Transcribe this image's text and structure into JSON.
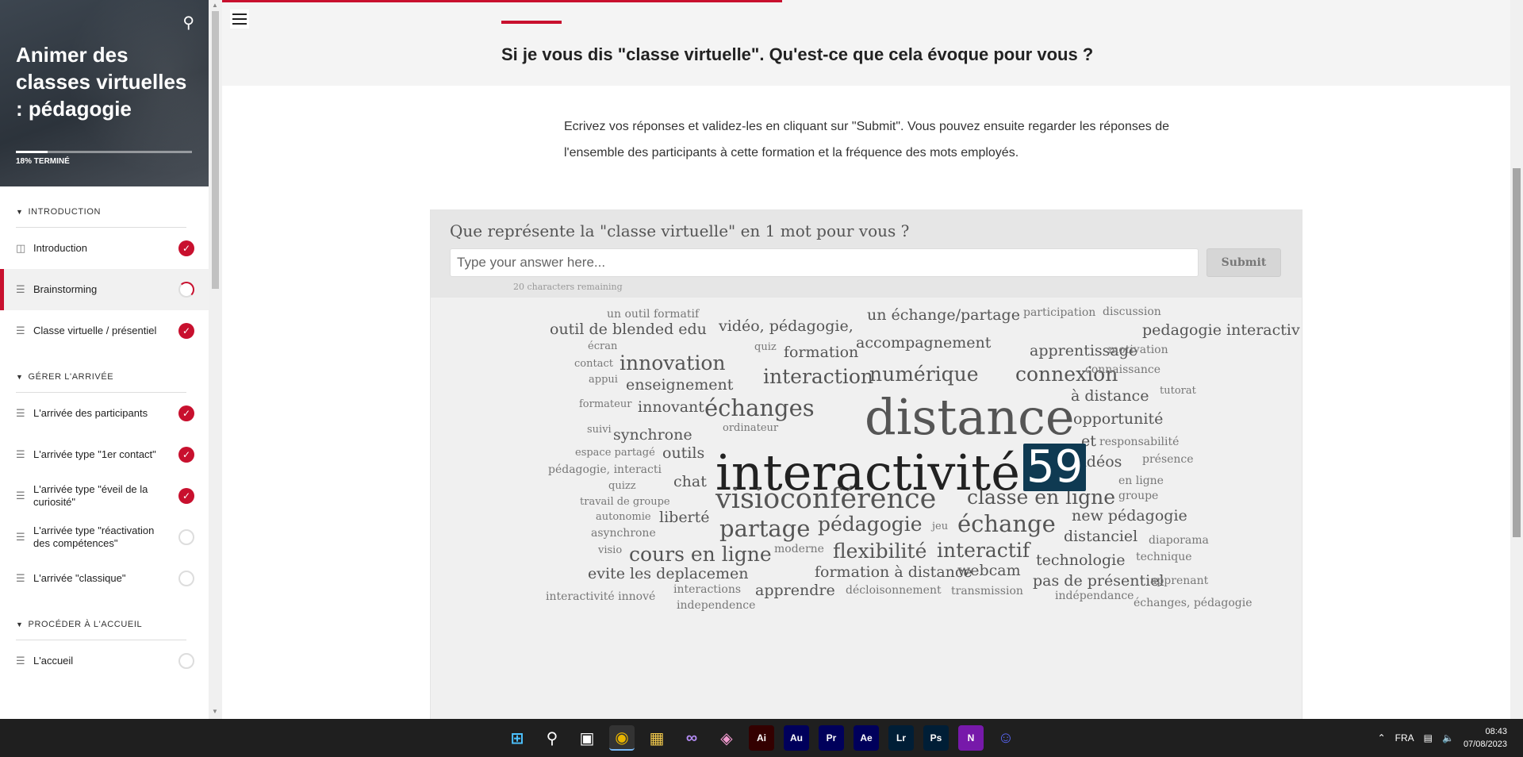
{
  "course": {
    "title": "Animer des classes virtuelles : pédagogie",
    "progress_label": "18% TERMINÉ",
    "progress_value": 0.18
  },
  "sidebar": {
    "sections": [
      {
        "title": "INTRODUCTION",
        "lessons": [
          {
            "label": "Introduction",
            "icon": "video-icon",
            "status": "done"
          },
          {
            "label": "Brainstorming",
            "icon": "lines-icon",
            "status": "partial",
            "active": true
          },
          {
            "label": "Classe virtuelle / présentiel",
            "icon": "lines-icon",
            "status": "done"
          }
        ]
      },
      {
        "title": "GÉRER L'ARRIVÉE",
        "lessons": [
          {
            "label": "L'arrivée des participants",
            "icon": "lines-icon",
            "status": "done"
          },
          {
            "label": "L'arrivée type \"1er contact\"",
            "icon": "lines-icon",
            "status": "done"
          },
          {
            "label": "L'arrivée type \"éveil de la curiosité\"",
            "icon": "lines-icon",
            "status": "done"
          },
          {
            "label": "L'arrivée type \"réactivation des compétences\"",
            "icon": "lines-icon",
            "status": "empty"
          },
          {
            "label": "L'arrivée \"classique\"",
            "icon": "lines-icon",
            "status": "empty"
          }
        ]
      },
      {
        "title": "PROCÉDER À L'ACCUEIL",
        "lessons": [
          {
            "label": "L'accueil",
            "icon": "lines-icon",
            "status": "empty"
          }
        ]
      }
    ]
  },
  "main": {
    "question": "Si je vous dis \"classe virtuelle\". Qu'est-ce que cela évoque pour vous ?",
    "intro": "Ecrivez vos réponses et validez-les en cliquant sur \"Submit\". Vous pouvez ensuite regarder les réponses de l'ensemble des participants à cette formation et la fréquence des mots employés.",
    "widget": {
      "question": "Que représente la \"classe virtuelle\" en 1 mot pour vous ?",
      "input_placeholder": "Type your answer here...",
      "submit_label": "Submit",
      "chars_remaining": "20 characters remaining"
    },
    "hovered_count": "59",
    "word_cloud": [
      {
        "text": "un outil formatif",
        "size": 14
      },
      {
        "text": "outil de blended edu",
        "size": 19
      },
      {
        "text": "vidéo, pédagogie,",
        "size": 19
      },
      {
        "text": "un échange/partage",
        "size": 19
      },
      {
        "text": "participation",
        "size": 14
      },
      {
        "text": "discussion",
        "size": 14
      },
      {
        "text": "pedagogie interactiv",
        "size": 19
      },
      {
        "text": "écran",
        "size": 13
      },
      {
        "text": "quiz",
        "size": 13
      },
      {
        "text": "contact",
        "size": 13
      },
      {
        "text": "innovation",
        "size": 25
      },
      {
        "text": "formation",
        "size": 19
      },
      {
        "text": "accompagnement",
        "size": 19
      },
      {
        "text": "apprentissage",
        "size": 19
      },
      {
        "text": "motivation",
        "size": 14
      },
      {
        "text": "appui",
        "size": 13
      },
      {
        "text": "enseignement",
        "size": 19
      },
      {
        "text": "interaction",
        "size": 25
      },
      {
        "text": "numérique",
        "size": 25
      },
      {
        "text": "connexion",
        "size": 25
      },
      {
        "text": "connaissance",
        "size": 14
      },
      {
        "text": "formateur",
        "size": 13
      },
      {
        "text": "innovant",
        "size": 19
      },
      {
        "text": "échanges",
        "size": 29
      },
      {
        "text": "distance",
        "size": 62
      },
      {
        "text": "à distance",
        "size": 19
      },
      {
        "text": "tutorat",
        "size": 13
      },
      {
        "text": "opportunité",
        "size": 19
      },
      {
        "text": "suivi",
        "size": 13
      },
      {
        "text": "synchrone",
        "size": 19
      },
      {
        "text": "ordinateur",
        "size": 13
      },
      {
        "text": "interactivité",
        "size": 62
      },
      {
        "text": "et",
        "size": 19
      },
      {
        "text": "responsabilité",
        "size": 14
      },
      {
        "text": "espace partagé",
        "size": 13
      },
      {
        "text": "outils",
        "size": 19
      },
      {
        "text": "vidéos",
        "size": 19
      },
      {
        "text": "présence",
        "size": 14
      },
      {
        "text": "pédagogie, interacti",
        "size": 14
      },
      {
        "text": "chat",
        "size": 19
      },
      {
        "text": "en ligne",
        "size": 14
      },
      {
        "text": "quizz",
        "size": 13
      },
      {
        "text": "visioconférence",
        "size": 35
      },
      {
        "text": "classe en ligne",
        "size": 25
      },
      {
        "text": "travail de groupe",
        "size": 13
      },
      {
        "text": "groupe",
        "size": 14
      },
      {
        "text": "autonomie",
        "size": 13
      },
      {
        "text": "liberté",
        "size": 19
      },
      {
        "text": "partage",
        "size": 29
      },
      {
        "text": "pédagogie",
        "size": 25
      },
      {
        "text": "jeu",
        "size": 13
      },
      {
        "text": "échange",
        "size": 29
      },
      {
        "text": "new pédagogie",
        "size": 19
      },
      {
        "text": "asynchrone",
        "size": 14
      },
      {
        "text": "distanciel",
        "size": 19
      },
      {
        "text": "diaporama",
        "size": 14
      },
      {
        "text": "visio",
        "size": 13
      },
      {
        "text": "cours en ligne",
        "size": 25
      },
      {
        "text": "moderne",
        "size": 14
      },
      {
        "text": "flexibilité",
        "size": 25
      },
      {
        "text": "interactif",
        "size": 25
      },
      {
        "text": "technologie",
        "size": 19
      },
      {
        "text": "technique",
        "size": 14
      },
      {
        "text": "evite les deplacemen",
        "size": 19
      },
      {
        "text": "formation à distance",
        "size": 19
      },
      {
        "text": "webcam",
        "size": 19
      },
      {
        "text": "interactions",
        "size": 14
      },
      {
        "text": "apprendre",
        "size": 19
      },
      {
        "text": "décloisonnement",
        "size": 14
      },
      {
        "text": "transmission",
        "size": 14
      },
      {
        "text": "pas de présentiel",
        "size": 19
      },
      {
        "text": "apprenant",
        "size": 14
      },
      {
        "text": "interactivité innové",
        "size": 14
      },
      {
        "text": "indépendance",
        "size": 14
      },
      {
        "text": "independence",
        "size": 14
      },
      {
        "text": "échanges, pédagogie",
        "size": 14
      }
    ]
  },
  "taskbar": {
    "apps": [
      "windows-start",
      "search",
      "task-view",
      "chrome",
      "file-explorer",
      "visual-studio",
      "photos",
      "illustrator",
      "audition",
      "premiere",
      "after-effects",
      "lightroom",
      "photoshop",
      "onenote",
      "discord"
    ],
    "app_labels": {
      "illustrator": "Ai",
      "audition": "Au",
      "premiere": "Pr",
      "after-effects": "Ae",
      "lightroom": "Lr",
      "photoshop": "Ps",
      "onenote": "N"
    },
    "language": "FRA",
    "time": "08:43",
    "date": "07/08/2023"
  },
  "colors": {
    "accent": "#c8102e",
    "badge": "#0f3a52",
    "cloud_strong": "#222222",
    "cloud_medium": "#555555",
    "cloud_light": "#777777"
  }
}
